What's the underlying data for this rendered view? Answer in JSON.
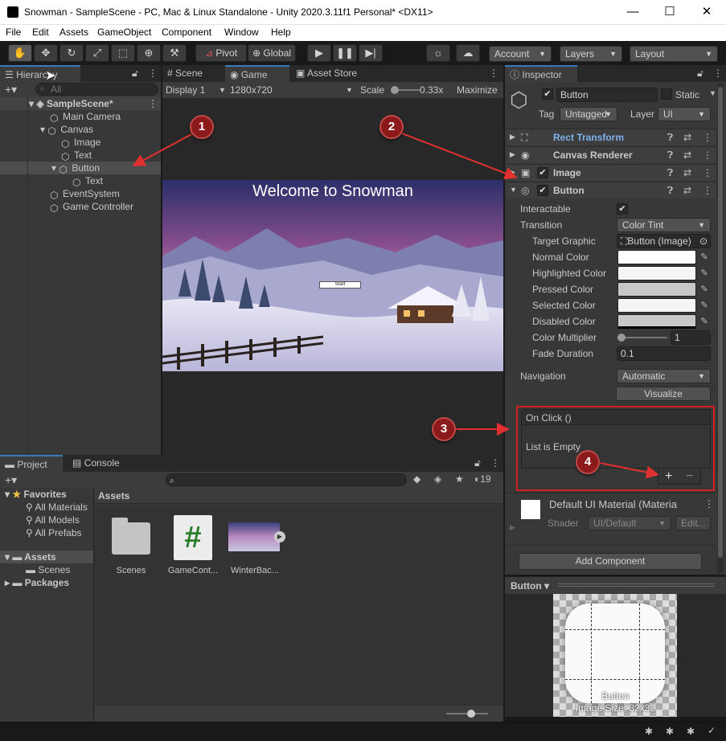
{
  "window": {
    "title": "Snowman - SampleScene - PC, Mac & Linux Standalone - Unity 2020.3.11f1 Personal* <DX11>",
    "minimize": "—",
    "maximize": "☐",
    "close": "✕"
  },
  "menu": [
    "File",
    "Edit",
    "Assets",
    "GameObject",
    "Component",
    "Window",
    "Help"
  ],
  "toolbar": {
    "pivot": "Pivot",
    "global": "Global",
    "account": "Account",
    "layers": "Layers",
    "layout": "Layout"
  },
  "hierarchy": {
    "tab": "Hierarchy",
    "search_placeholder": "All",
    "scene": "SampleScene*",
    "items": [
      "Main Camera",
      "Canvas",
      "Image",
      "Text",
      "Button",
      "Text",
      "EventSystem",
      "Game Controller"
    ]
  },
  "scene_tabs": {
    "scene": "Scene",
    "game": "Game",
    "asset_store": "Asset Store"
  },
  "game_view": {
    "display": "Display 1",
    "resolution": "1280x720",
    "scale_label": "Scale",
    "scale_value": "0.33x",
    "maximize": "Maximize",
    "welcome_text": "Welcome to Snowman",
    "start_button": "Start"
  },
  "inspector": {
    "tab": "Inspector",
    "object_name": "Button",
    "static_label": "Static",
    "tag_label": "Tag",
    "tag_value": "Untagged",
    "layer_label": "Layer",
    "layer_value": "UI",
    "components": {
      "rect_transform": "Rect Transform",
      "canvas_renderer": "Canvas Renderer",
      "image": "Image",
      "button": "Button"
    },
    "button_props": {
      "interactable": "Interactable",
      "transition": "Transition",
      "transition_value": "Color Tint",
      "target_graphic": "Target Graphic",
      "target_graphic_value": "Button (Image)",
      "normal_color": "Normal Color",
      "highlighted_color": "Highlighted Color",
      "pressed_color": "Pressed Color",
      "selected_color": "Selected Color",
      "disabled_color": "Disabled Color",
      "color_multiplier": "Color Multiplier",
      "color_multiplier_value": "1",
      "fade_duration": "Fade Duration",
      "fade_duration_value": "0.1",
      "navigation": "Navigation",
      "navigation_value": "Automatic",
      "visualize": "Visualize"
    },
    "on_click": {
      "header": "On Click ()",
      "empty": "List is Empty",
      "add": "+",
      "remove": "−"
    },
    "material": {
      "name": "Default UI Material (Materia",
      "shader_label": "Shader",
      "shader_value": "UI/Default",
      "edit": "Edit..."
    },
    "add_component": "Add Component",
    "preview": {
      "dropdown": "Button",
      "name": "Button",
      "size": "Image Size: 32x32"
    }
  },
  "project": {
    "tabs": {
      "project": "Project",
      "console": "Console"
    },
    "hidden_count": "19",
    "favorites": "Favorites",
    "favorite_items": [
      "All Materials",
      "All Models",
      "All Prefabs"
    ],
    "assets": "Assets",
    "asset_children": [
      "Scenes"
    ],
    "packages": "Packages",
    "breadcrumb": "Assets",
    "files": [
      "Scenes",
      "GameCont...",
      "WinterBac..."
    ]
  },
  "markers": [
    "1",
    "2",
    "3",
    "4"
  ],
  "colors": {
    "accent": "#3a79bb",
    "marker": "#8d1a1a",
    "highlight_box": "#d42020"
  }
}
